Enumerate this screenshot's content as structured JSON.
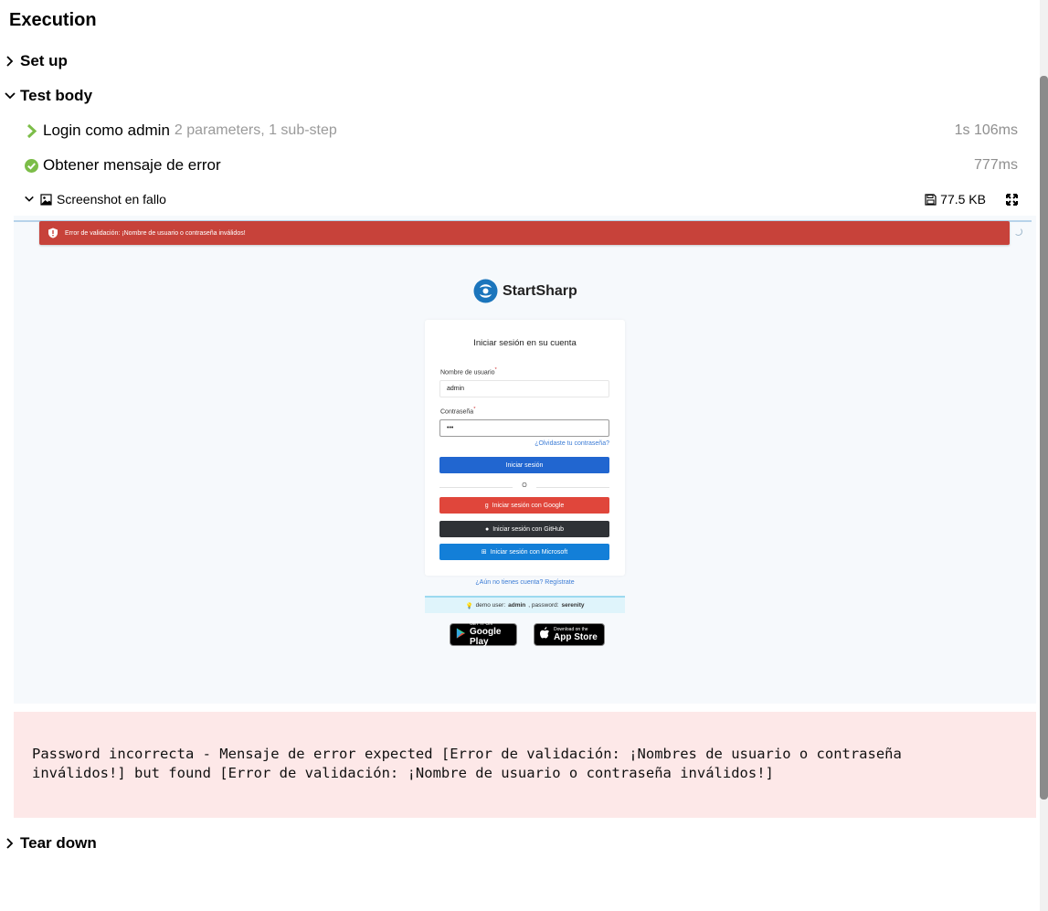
{
  "title": "Execution",
  "sections": {
    "setup": "Set up",
    "body": "Test body",
    "teardown": "Tear down"
  },
  "steps": [
    {
      "name": "Login como admin",
      "meta": "2 parameters, 1 sub-step",
      "duration": "1s 106ms",
      "icon": "chevron-right-icon",
      "color": "#7cbd48"
    },
    {
      "name": "Obtener mensaje de error",
      "meta": "",
      "duration": "777ms",
      "icon": "check-circle-icon",
      "color": "#7cbd48"
    }
  ],
  "attachment": {
    "name": "Screenshot en fallo",
    "size": "77.5 KB"
  },
  "screenshot": {
    "toast": "Error de validación: ¡Nombre de usuario o contraseña inválidos!",
    "brand": "StartSharp",
    "heading": "Iniciar sesión en su cuenta",
    "username_label": "Nombre de usuario",
    "username_value": "admin",
    "password_label": "Contraseña",
    "password_value": "•••",
    "required_mark": "*",
    "forgot": "¿Olvidaste tu contraseña?",
    "login_btn": "Iniciar sesión",
    "or": "O",
    "google_btn": "Iniciar sesión con Google",
    "github_btn": "Iniciar sesión con GitHub",
    "ms_btn": "Iniciar sesión con Microsoft",
    "register": "¿Aún no tienes cuenta? Regístrate",
    "demo_prefix": "demo user:",
    "demo_user": "admin",
    "demo_mid": ", password:",
    "demo_pass": "serenity",
    "google_play_small": "GET IT ON",
    "google_play_big": "Google Play",
    "app_store_small": "Download on the",
    "app_store_big": "App Store"
  },
  "error_message": "Password incorrecta - Mensaje de error expected [Error de validación: ¡Nombres de usuario o contraseña\ninválidos!] but found [Error de validación: ¡Nombre de usuario o contraseña inválidos!]",
  "colors": {
    "success": "#7cbd48",
    "error_bg": "#fde8e8",
    "toast": "#c7423a"
  }
}
